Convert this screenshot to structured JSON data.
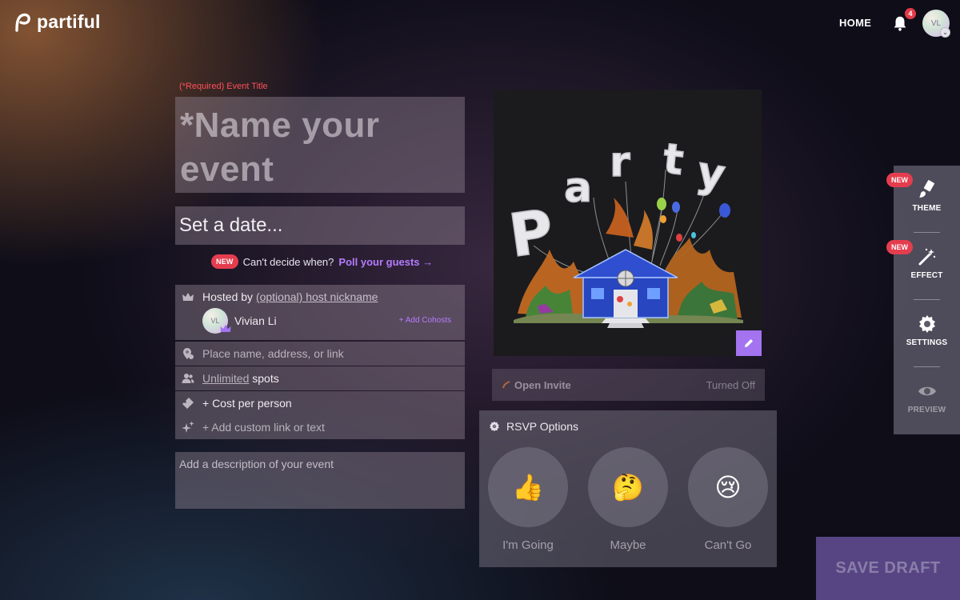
{
  "app": {
    "name": "partiful"
  },
  "nav": {
    "home_label": "HOME",
    "notifications_count": "4",
    "avatar_initials": "VL"
  },
  "form": {
    "title_required_label": "(*Required) Event Title",
    "title_placeholder": "*Name your event",
    "date_placeholder": "Set a date...",
    "poll": {
      "badge": "NEW",
      "prefix": "Can't decide when?",
      "link": "Poll your guests →"
    },
    "host": {
      "prefix": "Hosted by",
      "nickname_placeholder": "(optional) host nickname",
      "avatar_initials": "VL",
      "name": "Vivian Li",
      "add_cohosts": "+ Add Cohosts"
    },
    "location_placeholder": "Place name, address, or link",
    "spots": {
      "value": "Unlimited",
      "suffix": "spots"
    },
    "cost_label": "+ Cost per person",
    "custom_link_label": "+ Add custom link or text",
    "description_placeholder": "Add a description of your event"
  },
  "open_invite": {
    "label": "Open Invite",
    "status": "Turned Off"
  },
  "rsvp": {
    "title": "RSVP Options",
    "options": [
      {
        "emoji": "👍",
        "label": "I'm Going"
      },
      {
        "emoji": "🤔",
        "label": "Maybe"
      },
      {
        "emoji": "😢",
        "label": "Can't Go"
      }
    ]
  },
  "sidebar": {
    "new_badge": "NEW",
    "theme": "THEME",
    "effect": "EFFECT",
    "settings": "SETTINGS",
    "preview": "PREVIEW"
  },
  "actions": {
    "save_draft": "SAVE DRAFT"
  },
  "colors": {
    "accent_purple": "#a373f0",
    "link_purple": "#b47cff",
    "badge_red": "#e43d4e",
    "required_red": "#ff4f5a"
  }
}
